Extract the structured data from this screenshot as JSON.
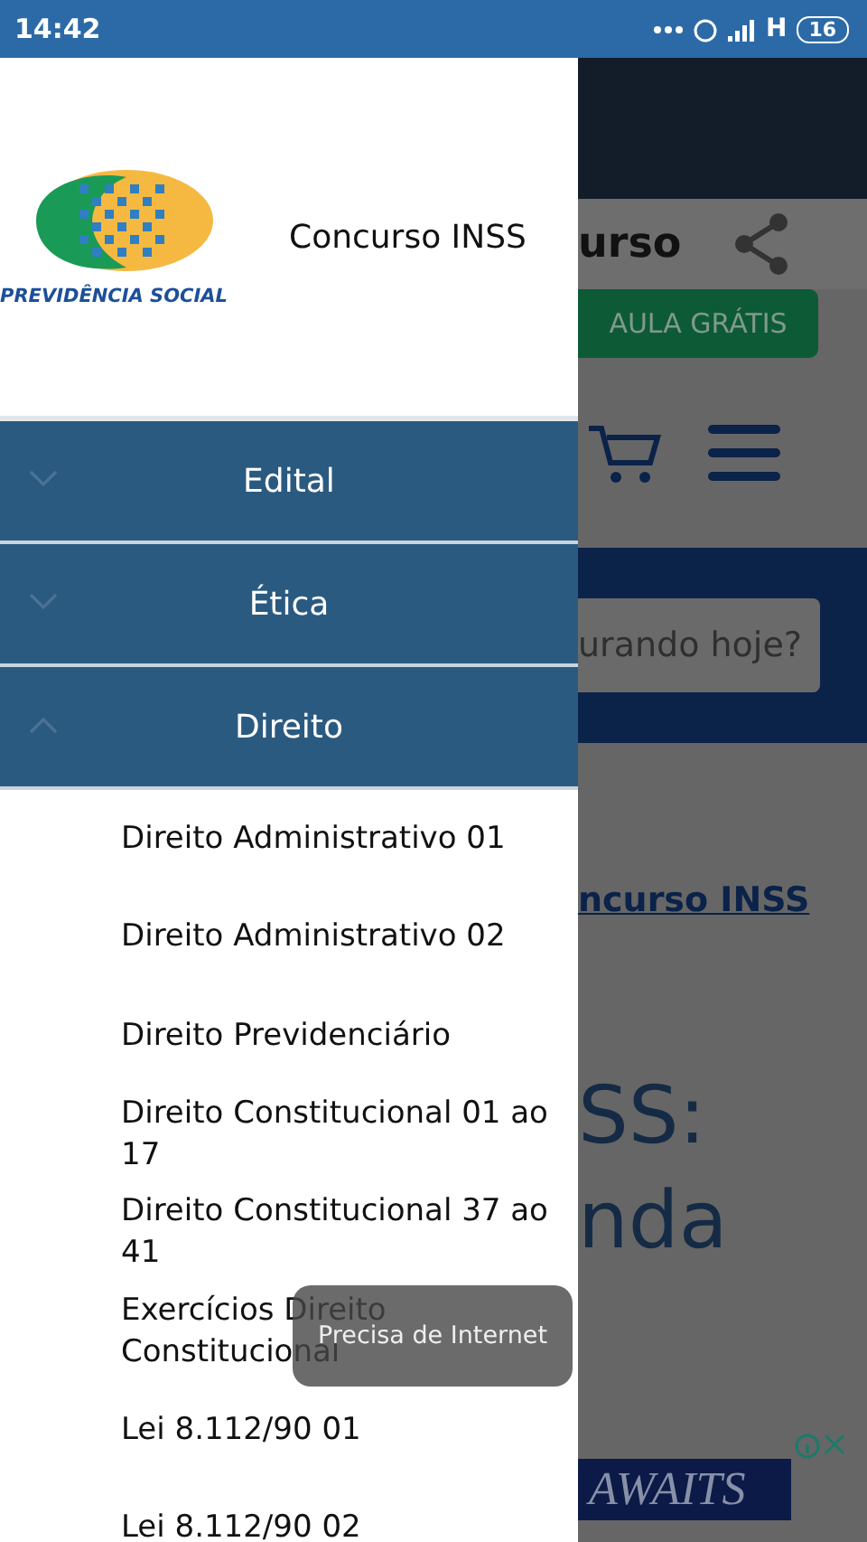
{
  "status_bar": {
    "time": "14:42",
    "network": "H",
    "battery": "16"
  },
  "drawer": {
    "logo_text": "PREVIDÊNCIA SOCIAL",
    "title": "Concurso INSS",
    "sections": [
      {
        "label": "Edital",
        "expanded": false
      },
      {
        "label": "Ética",
        "expanded": false
      },
      {
        "label": "Direito",
        "expanded": true,
        "items": [
          "Direito Administrativo 01",
          "Direito Administrativo 02",
          "Direito Previdenciário",
          "Direito Constitucional 01 ao 17",
          "Direito Constitucional 37 ao 41",
          "Exercícios Direito Constitucional",
          "Lei 8.112/90 01",
          "Lei 8.112/90 02"
        ]
      }
    ]
  },
  "background_page": {
    "title_fragment": "urso",
    "button": "AULA GRÁTIS",
    "search_placeholder": "urando hoje?",
    "link": "ncurso INSS",
    "heading_lines": [
      "SS:",
      "nda"
    ],
    "ad_text": "AWAITS"
  },
  "toast": "Precisa de Internet"
}
